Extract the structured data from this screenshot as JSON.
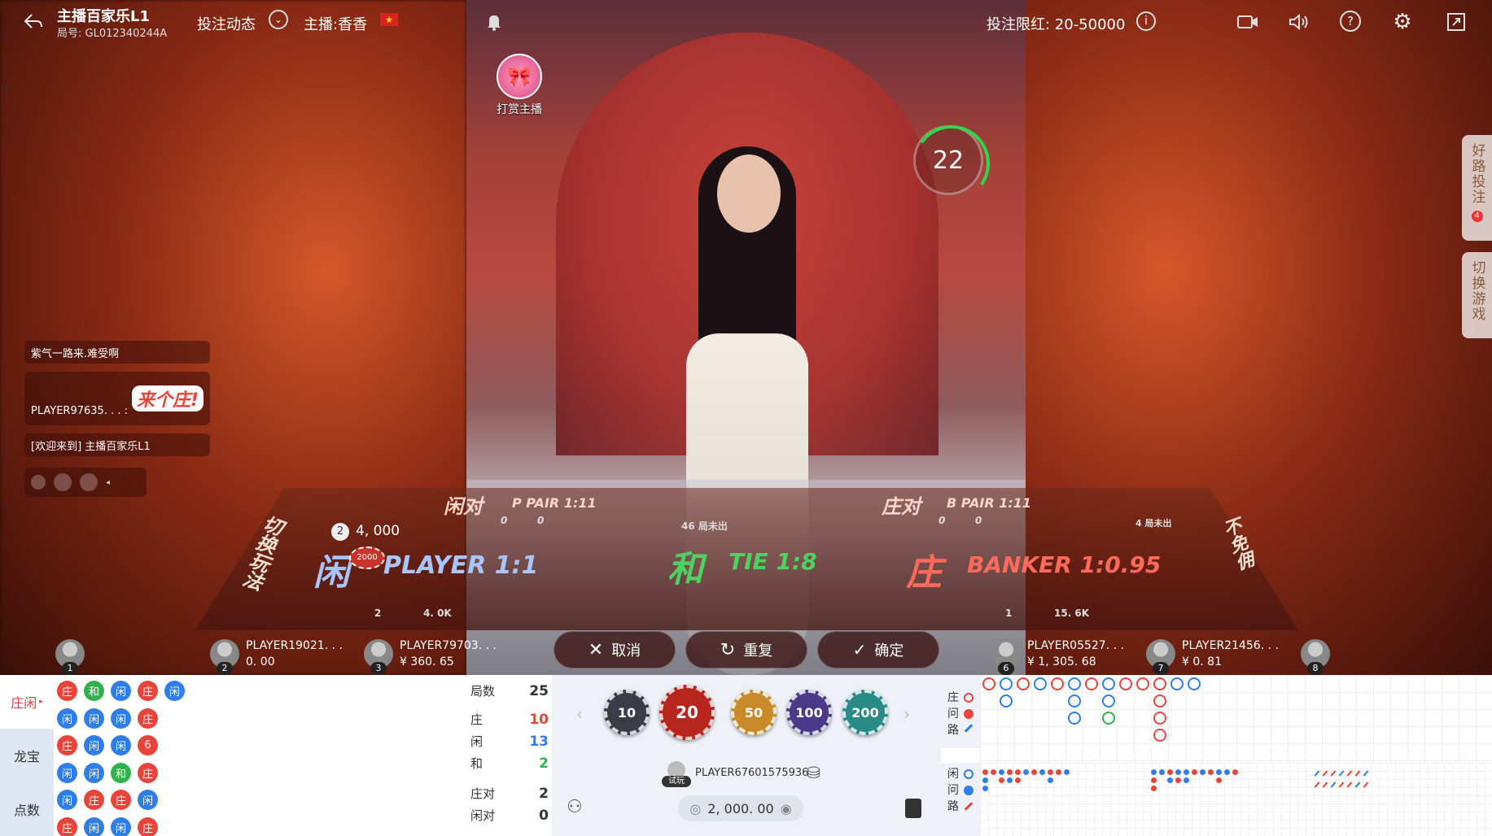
{
  "header": {
    "room_title": "主播百家乐L1",
    "room_id": "局号: GL012340244A",
    "bet_feed": "投注动态",
    "host_label": "主播:香香",
    "bet_limit": "投注限红: 20-50000"
  },
  "reward": {
    "label": "打赏主播"
  },
  "timer": {
    "seconds": "22"
  },
  "side_tabs": {
    "good_road": "好路投注",
    "good_road_badge": "4",
    "switch_game": "切换游戏"
  },
  "chat": {
    "line1": "紫气一路来.难受啊",
    "line2_user": "PLAYER97635. . . :",
    "line2_sticker": "来个庄!",
    "line3": "[欢迎来到] 主播百家乐L1"
  },
  "table": {
    "switch_method": "切换玩法",
    "no_commission": "不免佣",
    "p_pair": "闲对",
    "p_pair_en": "P PAIR 1:11",
    "b_pair": "庄对",
    "b_pair_en": "B PAIR 1:11",
    "player_cn": "闲",
    "player_en": "PLAYER 1:1",
    "tie_cn": "和",
    "tie_en": "TIE 1:8",
    "banker_cn": "庄",
    "banker_en": "BANKER 1:0.95",
    "player_bet_count": "2",
    "player_bet_amount": "4, 000",
    "player_chip": "2000",
    "p_pair_people": "0",
    "p_pair_amount": "0",
    "b_pair_people": "0",
    "b_pair_amount": "0",
    "tie_note": "46 局未出",
    "banker_note": "4 局未出",
    "player_people": "2",
    "player_amount": "4. 0K",
    "banker_people": "1",
    "banker_amount": "15. 6K"
  },
  "actions": {
    "cancel": "取消",
    "repeat": "重复",
    "confirm": "确定"
  },
  "seats": [
    {
      "num": "1",
      "name": "",
      "amount": ""
    },
    {
      "num": "2",
      "name": "PLAYER19021. . .",
      "amount": "0. 00"
    },
    {
      "num": "3",
      "name": "PLAYER79703. . .",
      "amount": "¥ 360. 65"
    },
    {
      "num": "6",
      "name": "PLAYER05527. . .",
      "amount": "¥ 1, 305. 68"
    },
    {
      "num": "7",
      "name": "PLAYER21456. . .",
      "amount": "¥ 0. 81"
    },
    {
      "num": "8",
      "name": "",
      "amount": ""
    }
  ],
  "bottom_tabs": [
    "庄闲",
    "龙宝",
    "点数"
  ],
  "stats": {
    "rounds_label": "局数",
    "rounds": "25",
    "banker_label": "庄",
    "banker": "10",
    "player_label": "闲",
    "player": "13",
    "tie_label": "和",
    "tie": "2",
    "bpair_label": "庄对",
    "bpair": "2",
    "ppair_label": "闲对",
    "ppair": "0"
  },
  "chips": [
    "10",
    "20",
    "50",
    "100",
    "200"
  ],
  "account": {
    "trial": "试玩",
    "player": "PLAYER67601575936",
    "balance": "2, 000. 00"
  },
  "road_labels": {
    "banker_ask": [
      "庄",
      "问",
      "路"
    ],
    "player_ask": [
      "闲",
      "问",
      "路"
    ]
  },
  "bead_road": [
    [
      "庄",
      "和",
      "闲",
      "庄",
      "闲"
    ],
    [
      "闲",
      "闲",
      "闲",
      "庄"
    ],
    [
      "庄",
      "闲",
      "闲",
      "6"
    ],
    [
      "闲",
      "闲",
      "和",
      "庄"
    ],
    [
      "闲",
      "庄",
      "庄",
      "闲"
    ],
    [
      "庄",
      "闲",
      "闲",
      "庄"
    ]
  ],
  "colors": {
    "banker": "#e8443c",
    "player": "#2f7de8",
    "tie": "#2fb24c",
    "accent": "#e04040"
  }
}
